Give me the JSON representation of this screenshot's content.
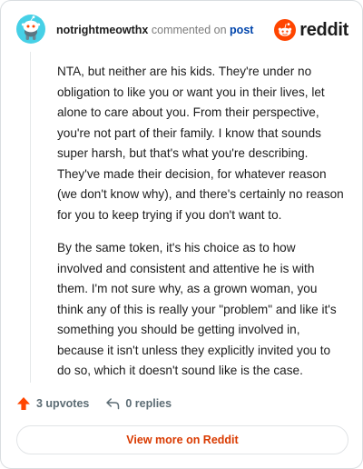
{
  "comment": {
    "username": "notrightmeowthx",
    "action_text": "commented on",
    "post_link": "post",
    "paragraphs": [
      "NTA, but neither are his kids. They're under no obligation to like you or want you in their lives, let alone to care about you. From their perspective, you're not part of their family. I know that sounds super harsh, but that's what you're describing. They've made their decision, for whatever reason (we don't know why), and there's certainly no reason for you to keep trying if you don't want to.",
      "By the same token, it's his choice as to how involved and consistent and attentive he is with them. I'm not sure why, as a grown woman, you think any of this is really your \"problem\" and like it's something you should be getting involved in, because it isn't unless they explicitly invited you to do so, which it doesn't sound like is the case."
    ]
  },
  "brand": {
    "name": "reddit",
    "accent_color": "#ff4500"
  },
  "actions": {
    "upvotes": "3 upvotes",
    "replies": "0 replies"
  },
  "view_more": "View more on Reddit",
  "icons": [
    "avatar-icon",
    "reddit-logo-icon",
    "upvote-arrow-icon",
    "reply-icon"
  ]
}
